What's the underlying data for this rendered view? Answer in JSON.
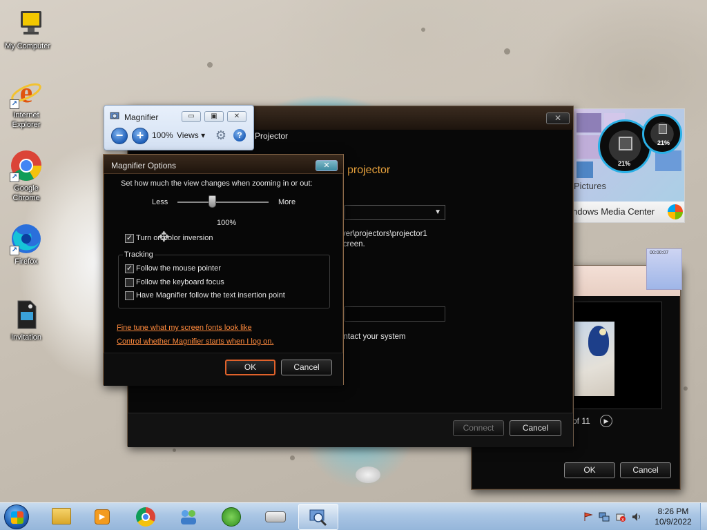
{
  "desktop": {
    "icons": [
      {
        "label": "My Computer",
        "icon": "computer-icon"
      },
      {
        "label": "Internet Explorer",
        "icon": "internet-explorer-icon"
      },
      {
        "label": "Google Chrome",
        "icon": "chrome-icon"
      },
      {
        "label": "Firefox",
        "icon": "firefox-icon"
      },
      {
        "label": "Invitation",
        "icon": "document-icon"
      }
    ]
  },
  "projector_window": {
    "title": "Projector",
    "heading_fragment": "projector",
    "path_fragment": "rver\\projectors\\projector1",
    "line2_fragment": "screen.",
    "contact_fragment": "ontact your system",
    "connect_label": "Connect",
    "cancel_label": "Cancel"
  },
  "magnifier": {
    "title": "Magnifier",
    "zoom_text": "100%",
    "views_label": "Views",
    "zoom_out_symbol": "−",
    "zoom_in_symbol": "+"
  },
  "magnifier_options": {
    "title": "Magnifier Options",
    "zoom_prompt": "Set how much the view changes when zooming in or out:",
    "slider_less": "Less",
    "slider_more": "More",
    "slider_value_text": "100%",
    "slider_value": 0.38,
    "color_inversion_label": "Turn on color inversion",
    "color_inversion_checked": true,
    "tracking_header": "Tracking",
    "tracking": [
      {
        "label": "Follow the mouse pointer",
        "checked": true
      },
      {
        "label": "Follow the keyboard focus",
        "checked": false
      },
      {
        "label": "Have Magnifier follow the text insertion point",
        "checked": false
      }
    ],
    "link_fonts": "Fine tune what my screen fonts look like",
    "link_startup": "Control whether Magnifier starts when I log on.",
    "ok_label": "OK",
    "cancel_label": "Cancel"
  },
  "media_gadget": {
    "pictures_label": "Pictures",
    "media_center_label": "ndows Media Center",
    "gauge_cpu": "21%",
    "gauge_mem": "21%",
    "clock_text": "00:00:07"
  },
  "slideshow_window": {
    "counter_text": "of 11",
    "ok_label": "OK",
    "cancel_label": "Cancel"
  },
  "taskbar": {
    "time": "8:26 PM",
    "date": "10/9/2022",
    "buttons": [
      "explorer-icon",
      "media-player-icon",
      "chrome-icon",
      "network-users-icon",
      "windows-update-icon",
      "projector-icon",
      "magnifier-icon"
    ]
  },
  "colors": {
    "accent_orange": "#e0622b",
    "link_orange": "#ff8a3d",
    "taskbar_blue": "#a9c5e4"
  }
}
